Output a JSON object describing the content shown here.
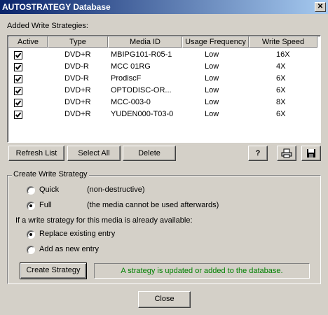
{
  "window": {
    "title": "AUTOSTRATEGY Database",
    "close_glyph": "✕"
  },
  "strategies": {
    "label": "Added Write Strategies:",
    "columns": [
      "Active",
      "Type",
      "Media ID",
      "Usage Frequency",
      "Write Speed"
    ],
    "rows": [
      {
        "active": true,
        "type": "DVD+R",
        "media_id": "MBIPG101-R05-1",
        "usage": "Low",
        "speed": "16X"
      },
      {
        "active": true,
        "type": "DVD-R",
        "media_id": "MCC 01RG",
        "usage": "Low",
        "speed": "4X"
      },
      {
        "active": true,
        "type": "DVD-R",
        "media_id": "ProdiscF",
        "usage": "Low",
        "speed": "6X"
      },
      {
        "active": true,
        "type": "DVD+R",
        "media_id": "OPTODISC-OR...",
        "usage": "Low",
        "speed": "6X"
      },
      {
        "active": true,
        "type": "DVD+R",
        "media_id": "MCC-003-0",
        "usage": "Low",
        "speed": "8X"
      },
      {
        "active": true,
        "type": "DVD+R",
        "media_id": "YUDEN000-T03-0",
        "usage": "Low",
        "speed": "6X"
      }
    ]
  },
  "toolbar": {
    "refresh_label": "Refresh List",
    "select_all_label": "Select All",
    "delete_label": "Delete",
    "help_label": "?",
    "print_icon": "printer-icon",
    "save_icon": "floppy-disk-icon"
  },
  "create": {
    "group_title": "Create Write Strategy",
    "quick_label": "Quick",
    "quick_desc": "(non-destructive)",
    "full_label": "Full",
    "full_desc": "(the media cannot be used afterwards)",
    "mode_selected": "Full",
    "exists_question": "If a write strategy for this media is already available:",
    "replace_label": "Replace existing entry",
    "add_label": "Add as new entry",
    "existing_selected": "Replace existing entry",
    "create_button": "Create Strategy",
    "status_text": "A strategy is updated or added to the database.",
    "status_color": "#008000"
  },
  "close_label": "Close"
}
